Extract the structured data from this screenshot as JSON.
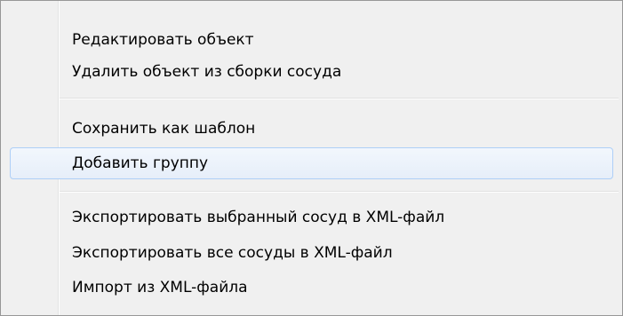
{
  "menu": {
    "items": [
      {
        "label": "Редактировать объект"
      },
      {
        "label": "Удалить объект из сборки сосуда"
      },
      {
        "label": "Сохранить как шаблон"
      },
      {
        "label": "Добавить группу"
      },
      {
        "label": "Экспортировать выбранный сосуд в XML-файл"
      },
      {
        "label": "Экспортировать все сосуды в XML-файл"
      },
      {
        "label": "Импорт из XML-файла"
      }
    ],
    "highlighted_index": 3,
    "colors": {
      "highlight_border": "#aecff7",
      "highlight_fill": "#e6eef9"
    }
  }
}
